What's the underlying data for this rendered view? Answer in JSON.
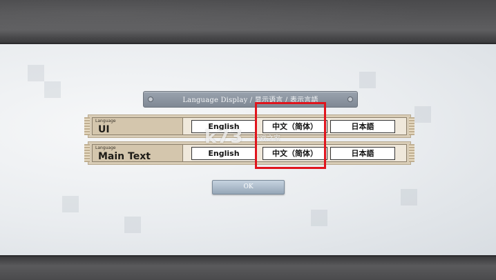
{
  "dialog": {
    "title": "Language Display / 显示语言 / 表示言語"
  },
  "rows": [
    {
      "small_label": "Language",
      "label": "UI",
      "options": [
        "English",
        "中文（简体）",
        "日本語"
      ]
    },
    {
      "small_label": "Language",
      "label": "Main Text",
      "options": [
        "English",
        "中文（简体）",
        "日本語"
      ]
    }
  ],
  "ok_label": "OK",
  "watermark": {
    "logo": "k73",
    "sub": "游戏之家"
  },
  "colors": {
    "highlight": "#e0141c",
    "title_plate": "#8a939e",
    "row_background": "#d9cdb7",
    "ok_button": "#a9b8c7"
  }
}
